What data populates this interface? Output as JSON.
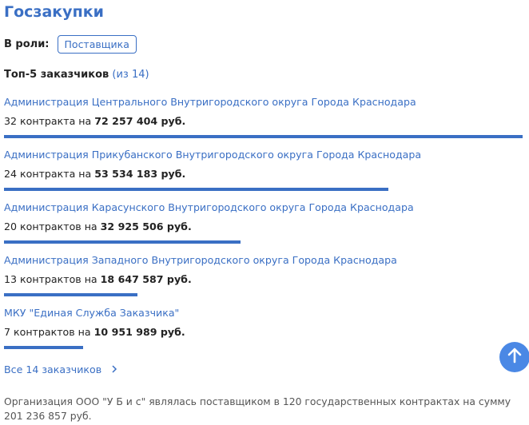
{
  "header": {
    "title": "Госзакупки"
  },
  "role": {
    "label": "В роли:",
    "value": "Поставщика"
  },
  "top": {
    "label": "Топ-5 заказчиков",
    "count": "(из 14)"
  },
  "customers": [
    {
      "name": "Администрация Центрального Внутригородского округа Города Краснодара",
      "contracts": "32 контракта на",
      "amount": "72 257 404 руб.",
      "share": 1.0
    },
    {
      "name": "Администрация Прикубанского Внутригородского округа Города Краснодара",
      "contracts": "24 контракта на",
      "amount": "53 534 183 руб.",
      "share": 0.741
    },
    {
      "name": "Администрация Карасунского Внутригородского округа Города Краснодара",
      "contracts": "20 контрактов на",
      "amount": "32 925 506 руб.",
      "share": 0.456
    },
    {
      "name": "Администрация Западного Внутригородского округа Города Краснодара",
      "contracts": "13 контрактов на",
      "amount": "18 647 587 руб.",
      "share": 0.258
    },
    {
      "name": "МКУ \"Единая Служба Заказчика\"",
      "contracts": "7 контрактов на",
      "amount": "10 951 989 руб.",
      "share": 0.152
    }
  ],
  "all_link": {
    "label": "Все 14 заказчиков"
  },
  "summary": "Организация ООО \"У Б и с\" являлась поставщиком в 120 государственных контрактах на сумму 201 236 857 руб.",
  "colors": {
    "accent": "#3a6fc4",
    "fab": "#4a88e5"
  },
  "icons": {
    "chevron": "chevron-right-icon",
    "scroll_top": "arrow-up-icon"
  }
}
